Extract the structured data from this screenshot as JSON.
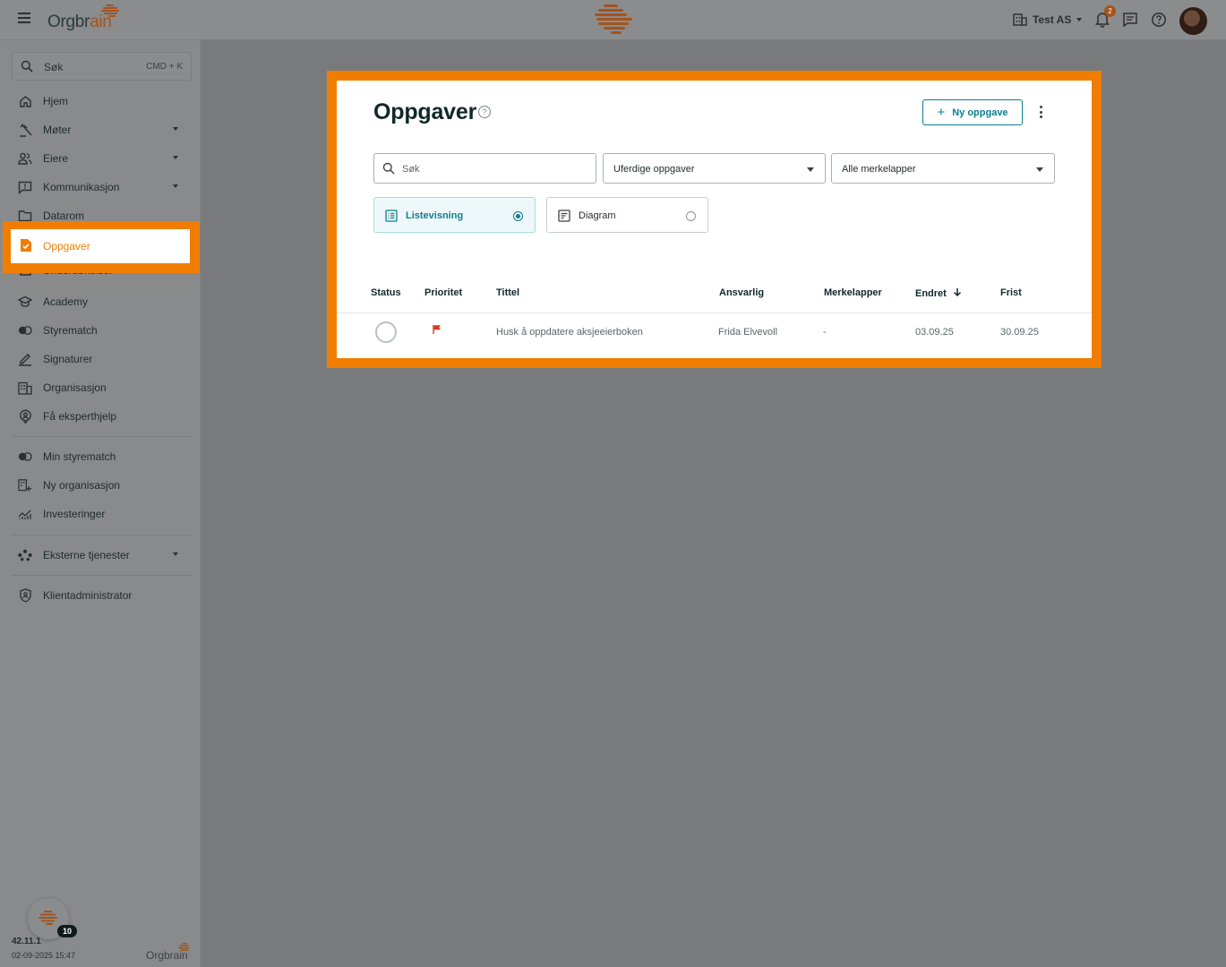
{
  "topbar": {
    "logo_text_a": "Orgbr",
    "logo_text_b": "ain",
    "org_name": "Test AS",
    "notification_count": "2"
  },
  "sidebar": {
    "search_placeholder": "Søk",
    "search_shortcut": "CMD + K",
    "items": [
      {
        "label": "Hjem"
      },
      {
        "label": "Møter"
      },
      {
        "label": "Eiere"
      },
      {
        "label": "Kommunikasjon"
      },
      {
        "label": "Datarom"
      },
      {
        "label": "Oppgaver"
      },
      {
        "label": "Undersøkelser"
      },
      {
        "label": "Academy"
      },
      {
        "label": "Styrematch"
      },
      {
        "label": "Signaturer"
      },
      {
        "label": "Organisasjon"
      },
      {
        "label": "Få eksperthjelp"
      },
      {
        "label": "Min styrematch"
      },
      {
        "label": "Ny organisasjon"
      },
      {
        "label": "Investeringer"
      },
      {
        "label": "Eksterne tjenester"
      },
      {
        "label": "Klientadministrator"
      }
    ],
    "version": "42.11.1",
    "version_date": "02-09-2025 15:47",
    "fab_badge": "10",
    "footer_logo": "Orgbrain"
  },
  "main": {
    "title": "Oppgaver",
    "new_button_label": "Ny oppgave",
    "search_placeholder": "Søk",
    "status_filter": "Uferdige oppgaver",
    "tag_filter": "Alle merkelapper",
    "views": [
      {
        "label": "Listevisning",
        "selected": true
      },
      {
        "label": "Diagram",
        "selected": false
      }
    ],
    "table": {
      "headers": [
        "Status",
        "Prioritet",
        "Tittel",
        "Ansvarlig",
        "Merkelapper",
        "Endret",
        "Frist"
      ],
      "rows": [
        {
          "title": "Husk å oppdatere aksjeeierboken",
          "responsible": "Frida Elvevoll",
          "tags": "-",
          "changed": "03.09.25",
          "deadline": "30.09.25"
        }
      ]
    }
  },
  "colors": {
    "highlight": "#f07d00",
    "accent": "#0b7f8e",
    "priority_flag": "#d63b1f"
  }
}
